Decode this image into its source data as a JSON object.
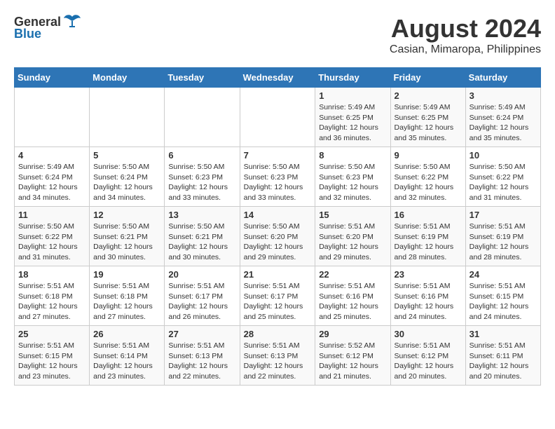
{
  "logo": {
    "general": "General",
    "blue": "Blue"
  },
  "title": {
    "month_year": "August 2024",
    "location": "Casian, Mimaropa, Philippines"
  },
  "headers": [
    "Sunday",
    "Monday",
    "Tuesday",
    "Wednesday",
    "Thursday",
    "Friday",
    "Saturday"
  ],
  "weeks": [
    [
      {
        "day": "",
        "info": ""
      },
      {
        "day": "",
        "info": ""
      },
      {
        "day": "",
        "info": ""
      },
      {
        "day": "",
        "info": ""
      },
      {
        "day": "1",
        "info": "Sunrise: 5:49 AM\nSunset: 6:25 PM\nDaylight: 12 hours\nand 36 minutes."
      },
      {
        "day": "2",
        "info": "Sunrise: 5:49 AM\nSunset: 6:25 PM\nDaylight: 12 hours\nand 35 minutes."
      },
      {
        "day": "3",
        "info": "Sunrise: 5:49 AM\nSunset: 6:24 PM\nDaylight: 12 hours\nand 35 minutes."
      }
    ],
    [
      {
        "day": "4",
        "info": "Sunrise: 5:49 AM\nSunset: 6:24 PM\nDaylight: 12 hours\nand 34 minutes."
      },
      {
        "day": "5",
        "info": "Sunrise: 5:50 AM\nSunset: 6:24 PM\nDaylight: 12 hours\nand 34 minutes."
      },
      {
        "day": "6",
        "info": "Sunrise: 5:50 AM\nSunset: 6:23 PM\nDaylight: 12 hours\nand 33 minutes."
      },
      {
        "day": "7",
        "info": "Sunrise: 5:50 AM\nSunset: 6:23 PM\nDaylight: 12 hours\nand 33 minutes."
      },
      {
        "day": "8",
        "info": "Sunrise: 5:50 AM\nSunset: 6:23 PM\nDaylight: 12 hours\nand 32 minutes."
      },
      {
        "day": "9",
        "info": "Sunrise: 5:50 AM\nSunset: 6:22 PM\nDaylight: 12 hours\nand 32 minutes."
      },
      {
        "day": "10",
        "info": "Sunrise: 5:50 AM\nSunset: 6:22 PM\nDaylight: 12 hours\nand 31 minutes."
      }
    ],
    [
      {
        "day": "11",
        "info": "Sunrise: 5:50 AM\nSunset: 6:22 PM\nDaylight: 12 hours\nand 31 minutes."
      },
      {
        "day": "12",
        "info": "Sunrise: 5:50 AM\nSunset: 6:21 PM\nDaylight: 12 hours\nand 30 minutes."
      },
      {
        "day": "13",
        "info": "Sunrise: 5:50 AM\nSunset: 6:21 PM\nDaylight: 12 hours\nand 30 minutes."
      },
      {
        "day": "14",
        "info": "Sunrise: 5:50 AM\nSunset: 6:20 PM\nDaylight: 12 hours\nand 29 minutes."
      },
      {
        "day": "15",
        "info": "Sunrise: 5:51 AM\nSunset: 6:20 PM\nDaylight: 12 hours\nand 29 minutes."
      },
      {
        "day": "16",
        "info": "Sunrise: 5:51 AM\nSunset: 6:19 PM\nDaylight: 12 hours\nand 28 minutes."
      },
      {
        "day": "17",
        "info": "Sunrise: 5:51 AM\nSunset: 6:19 PM\nDaylight: 12 hours\nand 28 minutes."
      }
    ],
    [
      {
        "day": "18",
        "info": "Sunrise: 5:51 AM\nSunset: 6:18 PM\nDaylight: 12 hours\nand 27 minutes."
      },
      {
        "day": "19",
        "info": "Sunrise: 5:51 AM\nSunset: 6:18 PM\nDaylight: 12 hours\nand 27 minutes."
      },
      {
        "day": "20",
        "info": "Sunrise: 5:51 AM\nSunset: 6:17 PM\nDaylight: 12 hours\nand 26 minutes."
      },
      {
        "day": "21",
        "info": "Sunrise: 5:51 AM\nSunset: 6:17 PM\nDaylight: 12 hours\nand 25 minutes."
      },
      {
        "day": "22",
        "info": "Sunrise: 5:51 AM\nSunset: 6:16 PM\nDaylight: 12 hours\nand 25 minutes."
      },
      {
        "day": "23",
        "info": "Sunrise: 5:51 AM\nSunset: 6:16 PM\nDaylight: 12 hours\nand 24 minutes."
      },
      {
        "day": "24",
        "info": "Sunrise: 5:51 AM\nSunset: 6:15 PM\nDaylight: 12 hours\nand 24 minutes."
      }
    ],
    [
      {
        "day": "25",
        "info": "Sunrise: 5:51 AM\nSunset: 6:15 PM\nDaylight: 12 hours\nand 23 minutes."
      },
      {
        "day": "26",
        "info": "Sunrise: 5:51 AM\nSunset: 6:14 PM\nDaylight: 12 hours\nand 23 minutes."
      },
      {
        "day": "27",
        "info": "Sunrise: 5:51 AM\nSunset: 6:13 PM\nDaylight: 12 hours\nand 22 minutes."
      },
      {
        "day": "28",
        "info": "Sunrise: 5:51 AM\nSunset: 6:13 PM\nDaylight: 12 hours\nand 22 minutes."
      },
      {
        "day": "29",
        "info": "Sunrise: 5:52 AM\nSunset: 6:12 PM\nDaylight: 12 hours\nand 21 minutes."
      },
      {
        "day": "30",
        "info": "Sunrise: 5:51 AM\nSunset: 6:12 PM\nDaylight: 12 hours\nand 20 minutes."
      },
      {
        "day": "31",
        "info": "Sunrise: 5:51 AM\nSunset: 6:11 PM\nDaylight: 12 hours\nand 20 minutes."
      }
    ]
  ]
}
